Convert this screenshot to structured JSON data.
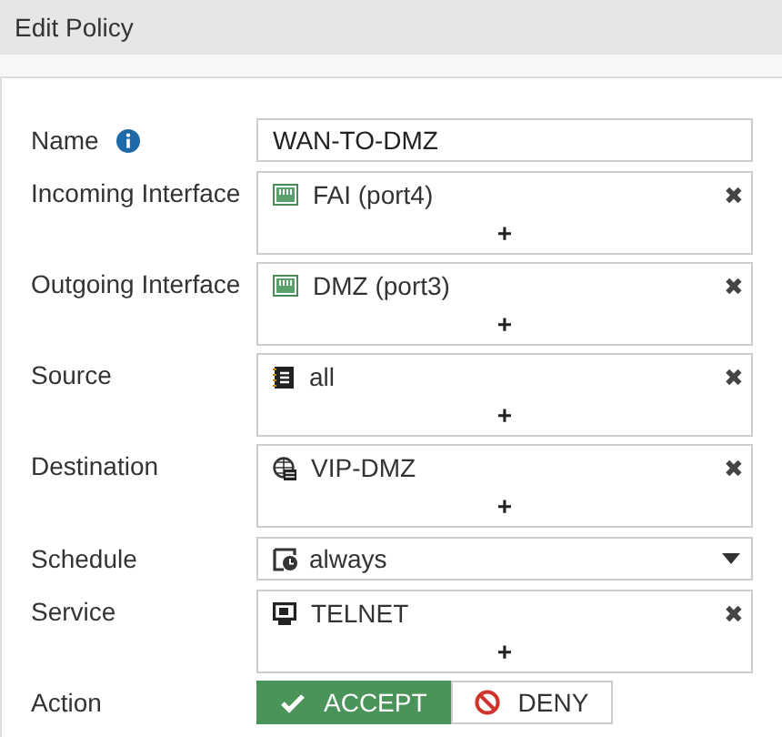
{
  "window": {
    "title": "Edit Policy"
  },
  "fields": [
    {
      "kind": "text",
      "label": "Name",
      "info": true,
      "value": "WAN-TO-DMZ"
    },
    {
      "kind": "multi",
      "label": "Incoming Interface",
      "add": "+",
      "entries": [
        {
          "kind": "interface",
          "text": "FAI (port4)",
          "remove": "✖"
        }
      ]
    },
    {
      "kind": "multi",
      "label": "Outgoing Interface",
      "add": "+",
      "entries": [
        {
          "kind": "interface",
          "text": "DMZ (port3)",
          "remove": "✖"
        }
      ]
    },
    {
      "kind": "multi",
      "label": "Source",
      "add": "+",
      "entries": [
        {
          "kind": "address",
          "text": "all",
          "remove": "✖"
        }
      ]
    },
    {
      "kind": "multi",
      "label": "Destination",
      "add": "+",
      "entries": [
        {
          "kind": "vip",
          "text": "VIP-DMZ",
          "remove": "✖"
        }
      ]
    },
    {
      "kind": "select",
      "label": "Schedule",
      "value": "always"
    },
    {
      "kind": "multi",
      "label": "Service",
      "add": "+",
      "entries": [
        {
          "kind": "service",
          "text": "TELNET",
          "remove": "✖"
        }
      ]
    },
    {
      "kind": "action",
      "label": "Action",
      "options": [
        {
          "kind": "accept",
          "label": "ACCEPT",
          "selected": true
        },
        {
          "kind": "deny",
          "label": "DENY",
          "selected": false
        }
      ]
    }
  ]
}
